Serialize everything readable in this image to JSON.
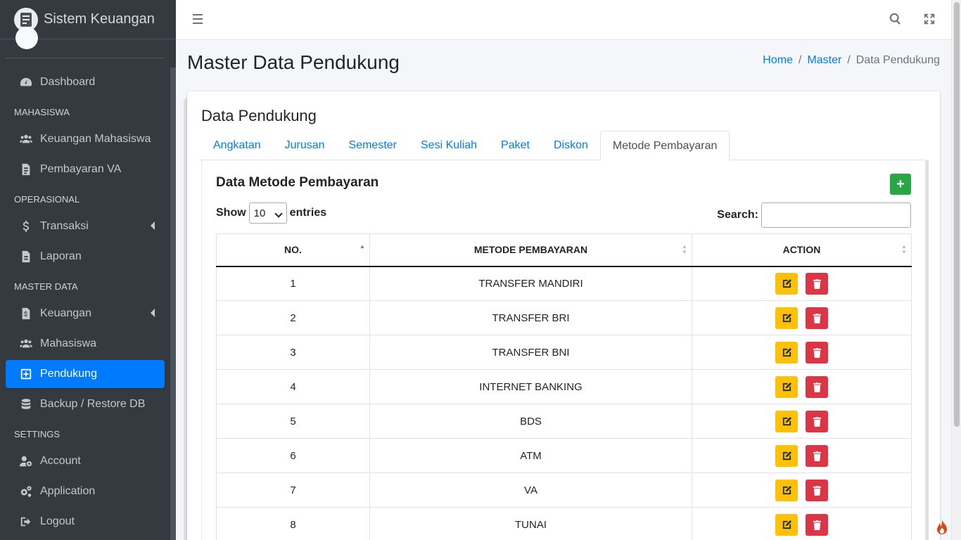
{
  "app": {
    "title": "Sistem Keuangan"
  },
  "sidebar": {
    "items": [
      {
        "type": "item",
        "label": "Dashboard",
        "icon": "dashboard-icon"
      },
      {
        "type": "header",
        "label": "MAHASISWA"
      },
      {
        "type": "item",
        "label": "Keuangan Mahasiswa",
        "icon": "users-icon"
      },
      {
        "type": "item",
        "label": "Pembayaran VA",
        "icon": "file-invoice-icon"
      },
      {
        "type": "header",
        "label": "OPERASIONAL"
      },
      {
        "type": "item",
        "label": "Transaksi",
        "icon": "dollar-icon",
        "arrow": true
      },
      {
        "type": "item",
        "label": "Laporan",
        "icon": "file-icon"
      },
      {
        "type": "header",
        "label": "MASTER DATA"
      },
      {
        "type": "item",
        "label": "Keuangan",
        "icon": "file-invoice-dollar-icon",
        "arrow": true
      },
      {
        "type": "item",
        "label": "Mahasiswa",
        "icon": "users-icon"
      },
      {
        "type": "item",
        "label": "Pendukung",
        "icon": "plus-square-icon",
        "active": true
      },
      {
        "type": "item",
        "label": "Backup / Restore DB",
        "icon": "database-icon"
      },
      {
        "type": "header",
        "label": "SETTINGS"
      },
      {
        "type": "item",
        "label": "Account",
        "icon": "user-cog-icon"
      },
      {
        "type": "item",
        "label": "Application",
        "icon": "cogs-icon"
      },
      {
        "type": "item",
        "label": "Logout",
        "icon": "sign-out-icon"
      }
    ]
  },
  "page": {
    "title": "Master Data Pendukung",
    "breadcrumb": {
      "home": "Home",
      "master": "Master",
      "current": "Data Pendukung",
      "sep": "/"
    }
  },
  "card": {
    "title": "Data Pendukung",
    "tabs": [
      "Angkatan",
      "Jurusan",
      "Semester",
      "Sesi Kuliah",
      "Paket",
      "Diskon",
      "Metode Pembayaran"
    ],
    "active_tab": "Metode Pembayaran"
  },
  "panel": {
    "title": "Data Metode Pembayaran",
    "add_button": "+",
    "show_label": "Show",
    "entries_value": "10",
    "entries_label": "entries",
    "search_label": "Search:",
    "search_value": ""
  },
  "table": {
    "columns": [
      "NO.",
      "METODE PEMBAYARAN",
      "ACTION"
    ],
    "rows": [
      {
        "no": "1",
        "method": "TRANSFER MANDIRI"
      },
      {
        "no": "2",
        "method": "TRANSFER BRI"
      },
      {
        "no": "3",
        "method": "TRANSFER BNI"
      },
      {
        "no": "4",
        "method": "INTERNET BANKING"
      },
      {
        "no": "5",
        "method": "BDS"
      },
      {
        "no": "6",
        "method": "ATM"
      },
      {
        "no": "7",
        "method": "VA"
      },
      {
        "no": "8",
        "method": "TUNAI"
      }
    ]
  },
  "colors": {
    "sidebar_bg": "#343a40",
    "active": "#007bff",
    "edit": "#ffc107",
    "delete": "#dc3545",
    "add": "#28a745"
  }
}
